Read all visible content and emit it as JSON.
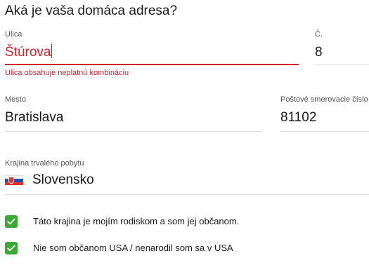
{
  "heading": "Aká je vaša domáca adresa?",
  "street": {
    "label": "Ulica",
    "value": "Štúrova",
    "error": "Ulica obsahuje neplatnú kombináciu"
  },
  "number": {
    "label": "Č.",
    "value": "8"
  },
  "city": {
    "label": "Mesto",
    "value": "Bratislava"
  },
  "postal": {
    "label": "Poštové smerovacie číslo",
    "value": "81102"
  },
  "country": {
    "label": "Krajina trvalého pobytu",
    "value": "Slovensko",
    "flag_icon": "slovakia-flag-icon"
  },
  "checks": [
    {
      "label": "Táto krajina je mojím rodiskom a som jej občanom.",
      "checked": true
    },
    {
      "label": "Nie som občanom USA / nenarodil som sa v USA",
      "checked": true
    }
  ],
  "colors": {
    "error": "#d81e2c",
    "checkbox": "#3aaa35",
    "divider": "#dcdcdc"
  }
}
